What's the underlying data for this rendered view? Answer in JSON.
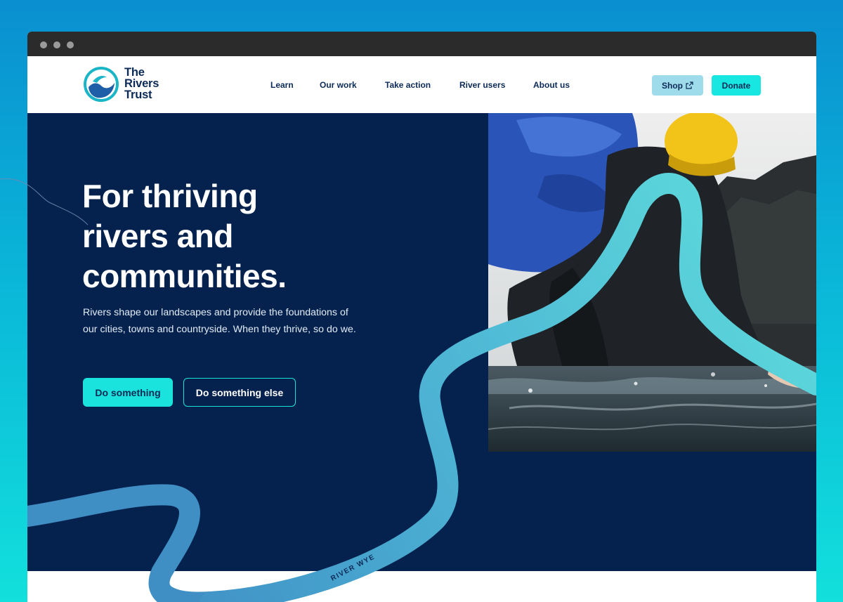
{
  "brand": {
    "line1": "The",
    "line2": "Rivers",
    "line3": "Trust"
  },
  "nav": [
    "Learn",
    "Our work",
    "Take action",
    "River users",
    "About us"
  ],
  "header_buttons": {
    "shop": "Shop",
    "shop_icon": "external-link-icon",
    "donate": "Donate"
  },
  "hero": {
    "headline": [
      "For thriving",
      "rivers and",
      "communities."
    ],
    "lead": "Rivers shape our landscapes and provide the foundations of our cities, towns and countryside. When they thrive, so do we.",
    "primary_cta": "Do something",
    "secondary_cta": "Do something else",
    "river_label": "RIVER WYE"
  },
  "colors": {
    "navy": "#05224e",
    "accent": "#1ae3dd",
    "shop_bg": "#9fdceb",
    "river_teal": "#5fe0dc",
    "river_blue": "#3f8fc4",
    "background_top": "#0a8fd0",
    "background_bottom": "#12e0dc"
  }
}
